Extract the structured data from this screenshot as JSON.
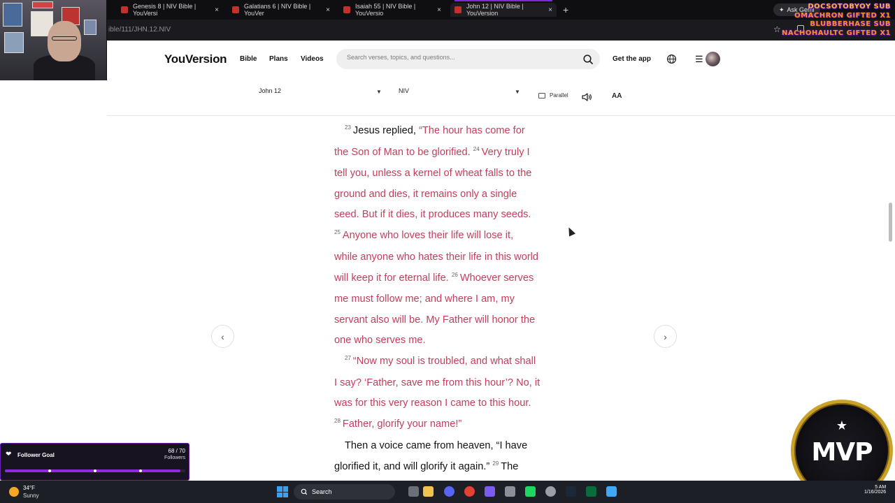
{
  "browser": {
    "tabs": [
      {
        "title": "Genesis 8 | NIV Bible | YouVersi",
        "active": false
      },
      {
        "title": "Galatians 6 | NIV Bible | YouVer",
        "active": false
      },
      {
        "title": "Isaiah 55 | NIV Bible | YouVersio",
        "active": false
      },
      {
        "title": "John 12 | NIV Bible | YouVersion",
        "active": true
      }
    ],
    "new_tab": "+",
    "close_glyph": "×",
    "url": "ible/111/JHN.12.NIV",
    "ask_gemini": "Ask Gemi"
  },
  "stream_alerts": [
    "DOCSOTOBYOY SUB",
    "OMACHRON GIFTED X1",
    "BLUBBERHASE SUB",
    "NACHOHAULTC GIFTED X1"
  ],
  "site": {
    "logo": "YouVersion",
    "nav": [
      "Bible",
      "Plans",
      "Videos"
    ],
    "search_placeholder": "Search verses, topics, and questions...",
    "get_app": "Get the app",
    "book_selector": "John 12",
    "version_selector": "NIV",
    "parallel": "Parallel",
    "font_size_label": "AA",
    "menu_glyph": "☰",
    "prev_glyph": "‹",
    "next_glyph": "›"
  },
  "reader": {
    "lines": [
      {
        "verse": "23",
        "black": "Jesus replied, ",
        "red": "“The hour has come for"
      },
      {
        "red": "the Son of Man to be glorified. ",
        "verse2": "24",
        "red2": "Very truly I"
      },
      {
        "red": "tell you, unless a kernel of wheat falls to the"
      },
      {
        "red": "ground and dies, it remains only a single"
      },
      {
        "red": "seed. But if it dies, it produces many seeds."
      },
      {
        "verse": "25",
        "red": "Anyone who loves their life will lose it,"
      },
      {
        "red": "while anyone who hates their life in this world"
      },
      {
        "red": "will keep it for eternal life. ",
        "verse2": "26",
        "red2": "Whoever serves"
      },
      {
        "red": "me must follow me; and where I am, my"
      },
      {
        "red": "servant also will be. My Father will honor the"
      },
      {
        "red": "one who serves me."
      },
      {
        "verse": "27",
        "red": "“Now my soul is troubled, and what shall"
      },
      {
        "red": "I say? ‘Father, save me from this hour’? No, it"
      },
      {
        "red": "was for this very reason I came to this hour."
      },
      {
        "verse": "28",
        "red": "Father, glorify your name!”"
      },
      {
        "black": "Then a voice came from heaven, “I have"
      },
      {
        "black": "glorified it, and will glorify it again.” ",
        "verse2": "29",
        "black2": "The"
      }
    ]
  },
  "follower_goal": {
    "title": "Follower Goal",
    "count": "68 / 70",
    "label": "Followers",
    "progress": 0.971
  },
  "mvp_badge": {
    "text": "MVP",
    "star": "★"
  },
  "taskbar": {
    "temperature": "34°F",
    "condition": "Sunny",
    "search": "Search",
    "clock": "5 AM\n1/16/2026"
  },
  "colors": {
    "words_of_jesus": "#c43d5c",
    "accent": "#7a2bd9"
  }
}
